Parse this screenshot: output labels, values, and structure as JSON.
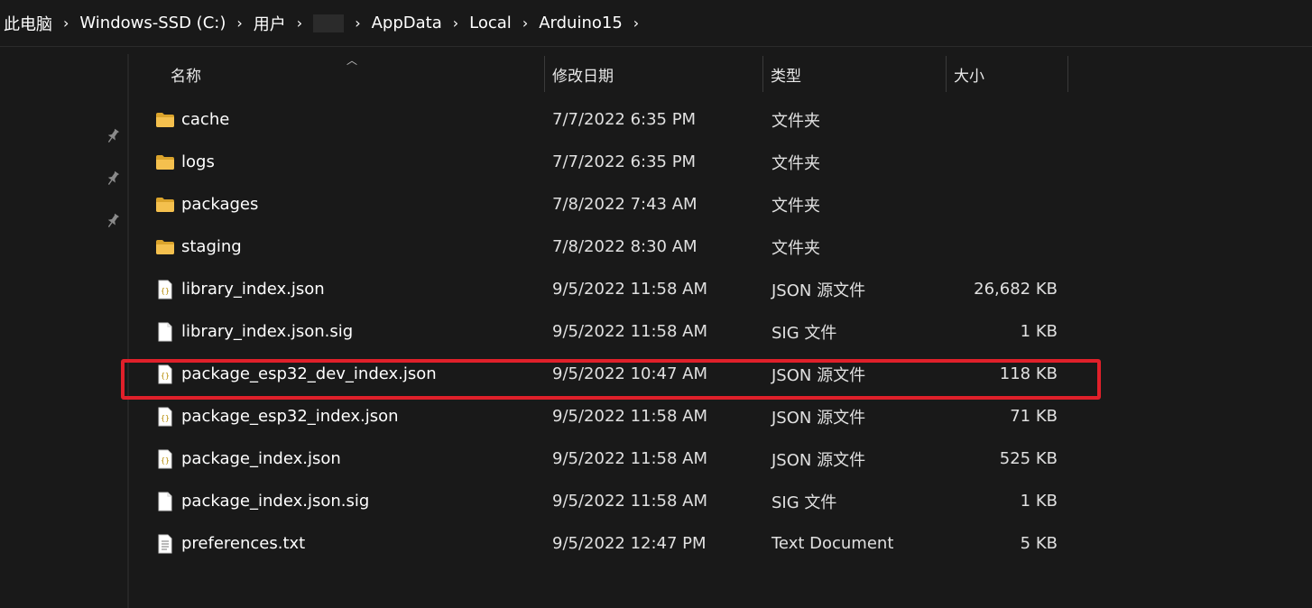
{
  "breadcrumb": {
    "items": [
      "此电脑",
      "Windows-SSD (C:)",
      "用户",
      "",
      "AppData",
      "Local",
      "Arduino15"
    ],
    "separator": "›"
  },
  "columns": {
    "name": "名称",
    "date": "修改日期",
    "type": "类型",
    "size": "大小"
  },
  "files": [
    {
      "icon": "folder-icon",
      "name": "cache",
      "date": "7/7/2022 6:35 PM",
      "type": "文件夹",
      "size": ""
    },
    {
      "icon": "folder-icon",
      "name": "logs",
      "date": "7/7/2022 6:35 PM",
      "type": "文件夹",
      "size": ""
    },
    {
      "icon": "folder-icon",
      "name": "packages",
      "date": "7/8/2022 7:43 AM",
      "type": "文件夹",
      "size": ""
    },
    {
      "icon": "folder-icon",
      "name": "staging",
      "date": "7/8/2022 8:30 AM",
      "type": "文件夹",
      "size": ""
    },
    {
      "icon": "json-file-icon",
      "name": "library_index.json",
      "date": "9/5/2022 11:58 AM",
      "type": "JSON 源文件",
      "size": "26,682 KB"
    },
    {
      "icon": "blank-file-icon",
      "name": "library_index.json.sig",
      "date": "9/5/2022 11:58 AM",
      "type": "SIG 文件",
      "size": "1 KB"
    },
    {
      "icon": "json-file-icon",
      "name": "package_esp32_dev_index.json",
      "date": "9/5/2022 10:47 AM",
      "type": "JSON 源文件",
      "size": "118 KB"
    },
    {
      "icon": "json-file-icon",
      "name": "package_esp32_index.json",
      "date": "9/5/2022 11:58 AM",
      "type": "JSON 源文件",
      "size": "71 KB"
    },
    {
      "icon": "json-file-icon",
      "name": "package_index.json",
      "date": "9/5/2022 11:58 AM",
      "type": "JSON 源文件",
      "size": "525 KB"
    },
    {
      "icon": "blank-file-icon",
      "name": "package_index.json.sig",
      "date": "9/5/2022 11:58 AM",
      "type": "SIG 文件",
      "size": "1 KB"
    },
    {
      "icon": "text-file-icon",
      "name": "preferences.txt",
      "date": "9/5/2022 12:47 PM",
      "type": "Text Document",
      "size": "5 KB"
    }
  ],
  "colors": {
    "background": "#191919",
    "highlight": "#e0202a",
    "folder": "#f4c04e"
  }
}
